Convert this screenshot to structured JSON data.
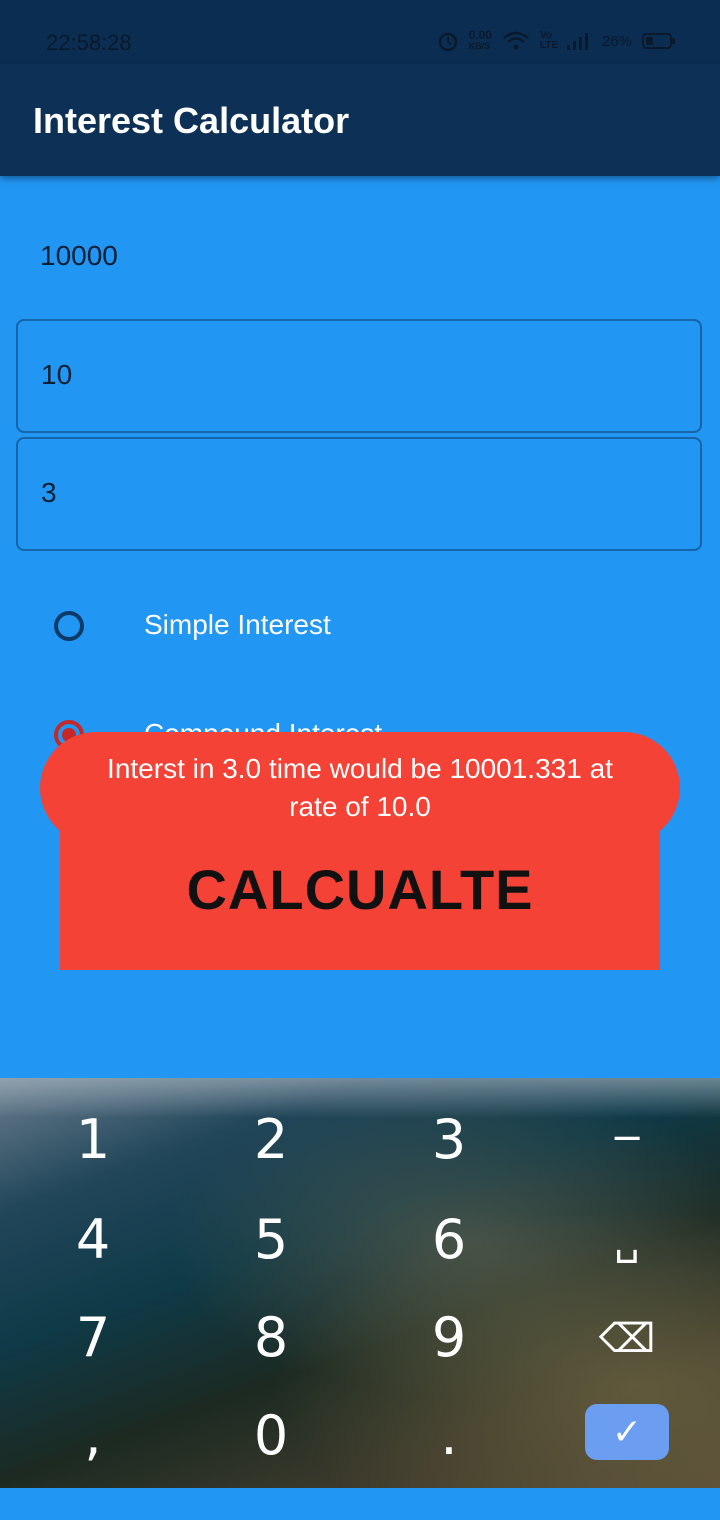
{
  "status_bar": {
    "time": "22:58:28",
    "speed": "0.00",
    "speed_unit": "KB/S",
    "volte": "Vo LTE",
    "battery": "26%"
  },
  "app_bar": {
    "title": "Interest Calculator"
  },
  "form": {
    "principal_value": "10000",
    "rate_value": "10",
    "time_value": "3"
  },
  "options": [
    {
      "label": "Simple Interest",
      "selected": false
    },
    {
      "label": "Compound Interest",
      "selected": true
    }
  ],
  "calculate_button": {
    "label": "CALCUALTE"
  },
  "toast": {
    "message": "Interst in 3.0 time would be 10001.331 at rate of 10.0"
  },
  "keypad": {
    "row1": [
      "1",
      "2",
      "3",
      "−"
    ],
    "row2": [
      "4",
      "5",
      "6",
      "␣"
    ],
    "row3": [
      "7",
      "8",
      "9",
      "⌫"
    ],
    "row4": [
      ",",
      "0",
      ".",
      "✓"
    ]
  },
  "colors": {
    "background": "#2196F3",
    "app_bar": "#0d3156",
    "button": "#f44336"
  }
}
